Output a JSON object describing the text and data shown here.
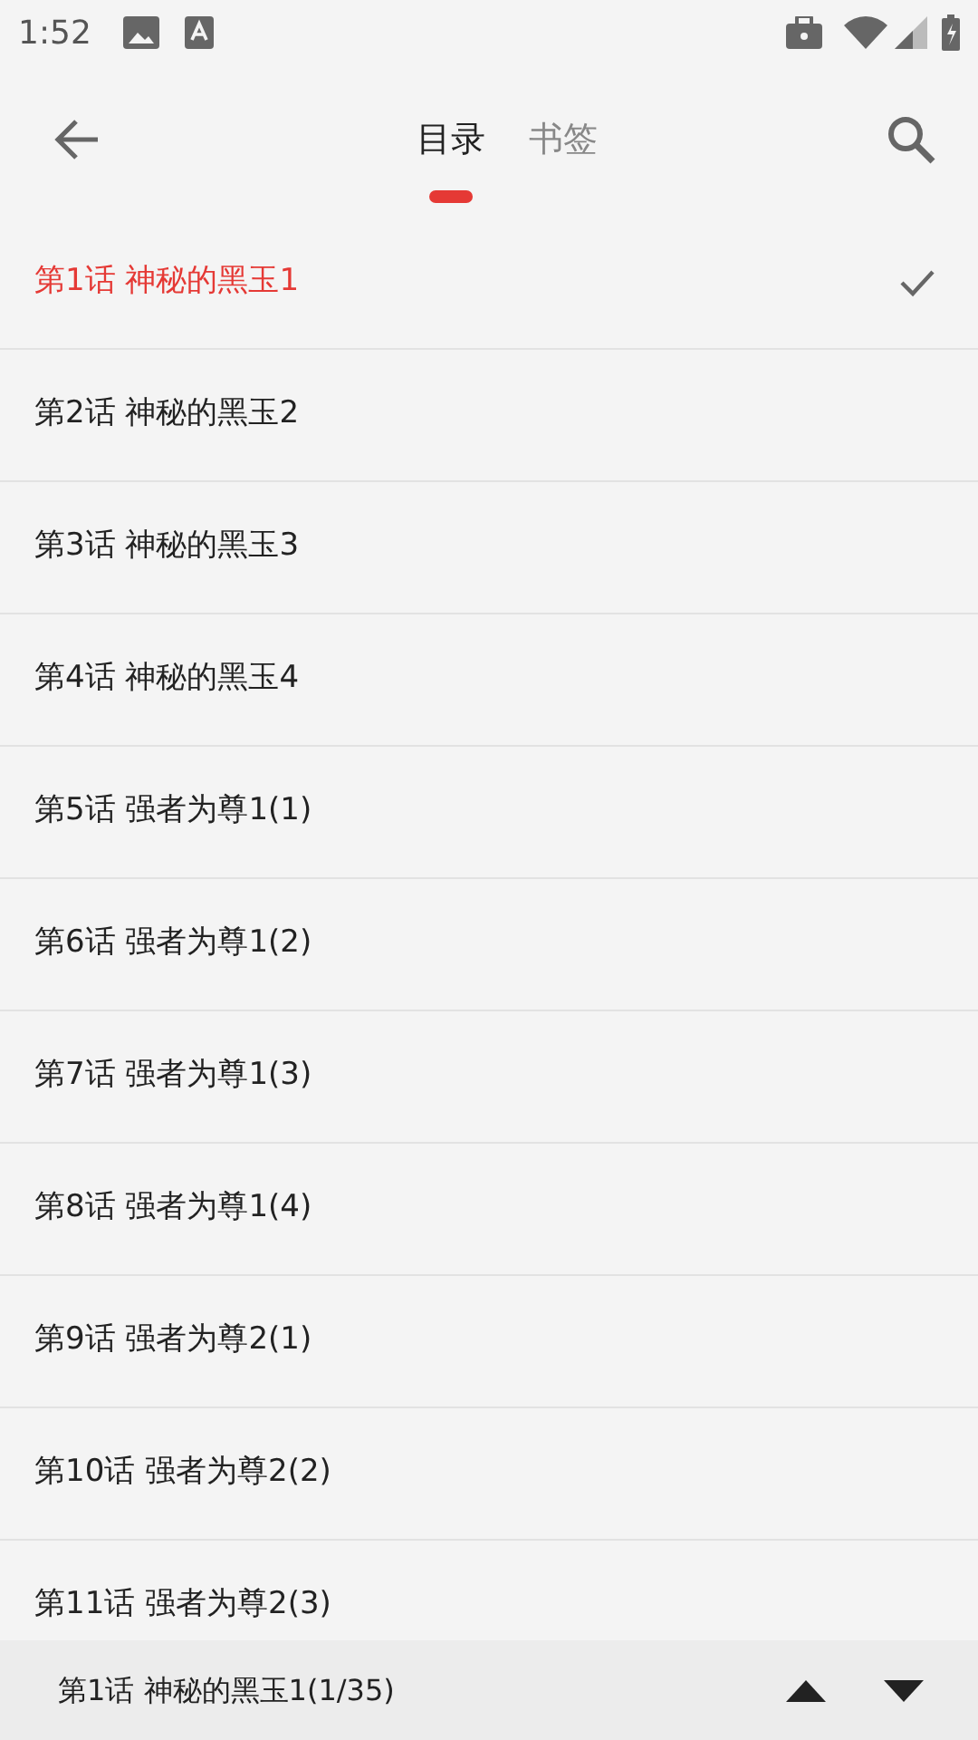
{
  "status_bar": {
    "time": "1:52"
  },
  "tabs": [
    {
      "label": "目录",
      "selected": true
    },
    {
      "label": "书签",
      "selected": false
    }
  ],
  "chapters": [
    {
      "title": "第1话 神秘的黑玉1",
      "selected": true
    },
    {
      "title": "第2话 神秘的黑玉2",
      "selected": false
    },
    {
      "title": "第3话 神秘的黑玉3",
      "selected": false
    },
    {
      "title": "第4话 神秘的黑玉4",
      "selected": false
    },
    {
      "title": "第5话 强者为尊1(1)",
      "selected": false
    },
    {
      "title": "第6话 强者为尊1(2)",
      "selected": false
    },
    {
      "title": "第7话 强者为尊1(3)",
      "selected": false
    },
    {
      "title": "第8话 强者为尊1(4)",
      "selected": false
    },
    {
      "title": "第9话 强者为尊2(1)",
      "selected": false
    },
    {
      "title": "第10话 强者为尊2(2)",
      "selected": false
    },
    {
      "title": "第11话 强者为尊2(3)",
      "selected": false
    }
  ],
  "bottom_bar": {
    "current": "第1话 神秘的黑玉1(1/35)"
  }
}
